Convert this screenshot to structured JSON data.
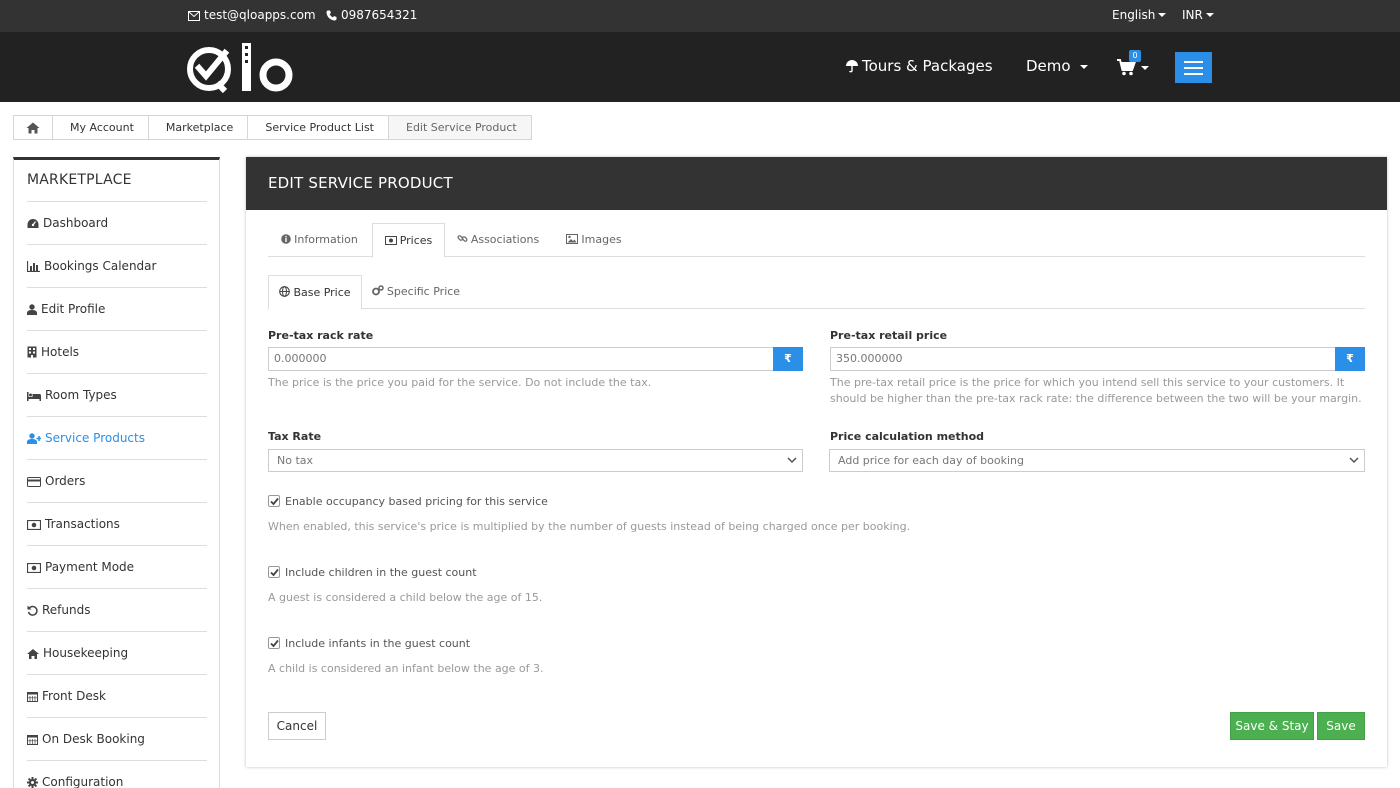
{
  "topbar": {
    "email": "test@qloapps.com",
    "phone": "0987654321",
    "language": "English",
    "currency": "INR"
  },
  "header": {
    "nav": [
      {
        "label": "Tours & Packages"
      },
      {
        "label": "Demo"
      }
    ],
    "cart_count": "0"
  },
  "breadcrumb": {
    "items": [
      "My Account",
      "Marketplace",
      "Service Product List",
      "Edit Service Product"
    ]
  },
  "sidebar": {
    "title": "MARKETPLACE",
    "items": [
      {
        "label": "Dashboard",
        "icon": "dashboard-icon"
      },
      {
        "label": "Bookings Calendar",
        "icon": "bar-chart-icon"
      },
      {
        "label": "Edit Profile",
        "icon": "user-icon"
      },
      {
        "label": "Hotels",
        "icon": "building-icon"
      },
      {
        "label": "Room Types",
        "icon": "bed-icon"
      },
      {
        "label": "Service Products",
        "icon": "user-plus-icon"
      },
      {
        "label": "Orders",
        "icon": "credit-card-icon"
      },
      {
        "label": "Transactions",
        "icon": "money-icon"
      },
      {
        "label": "Payment Mode",
        "icon": "money-icon"
      },
      {
        "label": "Refunds",
        "icon": "undo-icon"
      },
      {
        "label": "Housekeeping",
        "icon": "home-icon"
      },
      {
        "label": "Front Desk",
        "icon": "calendar-icon"
      },
      {
        "label": "On Desk Booking",
        "icon": "calendar-icon"
      },
      {
        "label": "Configuration",
        "icon": "gear-icon"
      }
    ],
    "active": "Service Products"
  },
  "panel": {
    "title": "EDIT SERVICE PRODUCT",
    "tabs": [
      {
        "label": "Information"
      },
      {
        "label": "Prices"
      },
      {
        "label": "Associations"
      },
      {
        "label": "Images"
      }
    ],
    "subtabs": [
      {
        "label": "Base Price"
      },
      {
        "label": "Specific Price"
      }
    ],
    "rack_rate": {
      "label": "Pre-tax rack rate",
      "value": "0.000000",
      "currency": "₹",
      "help": "The price is the price you paid for the service. Do not include the tax."
    },
    "retail_price": {
      "label": "Pre-tax retail price",
      "value": "350.000000",
      "currency": "₹",
      "help": "The pre-tax retail price is the price for which you intend sell this service to your customers. It should be higher than the pre-tax rack rate: the difference between the two will be your margin."
    },
    "tax_rate": {
      "label": "Tax Rate",
      "selected": "No tax"
    },
    "price_method": {
      "label": "Price calculation method",
      "selected": "Add price for each day of booking"
    },
    "checks": [
      {
        "label": "Enable occupancy based pricing for this service",
        "checked": true,
        "help": "When enabled, this service's price is multiplied by the number of guests instead of being charged once per booking."
      },
      {
        "label": "Include children in the guest count",
        "checked": true,
        "help": "A guest is considered a child below the age of 15."
      },
      {
        "label": "Include infants in the guest count",
        "checked": true,
        "help": "A child is considered an infant below the age of 3."
      }
    ],
    "buttons": {
      "cancel": "Cancel",
      "save_stay": "Save & Stay",
      "save": "Save"
    }
  },
  "colors": {
    "accent": "#2b8fe8",
    "success": "#4caf50",
    "dark": "#222222"
  }
}
